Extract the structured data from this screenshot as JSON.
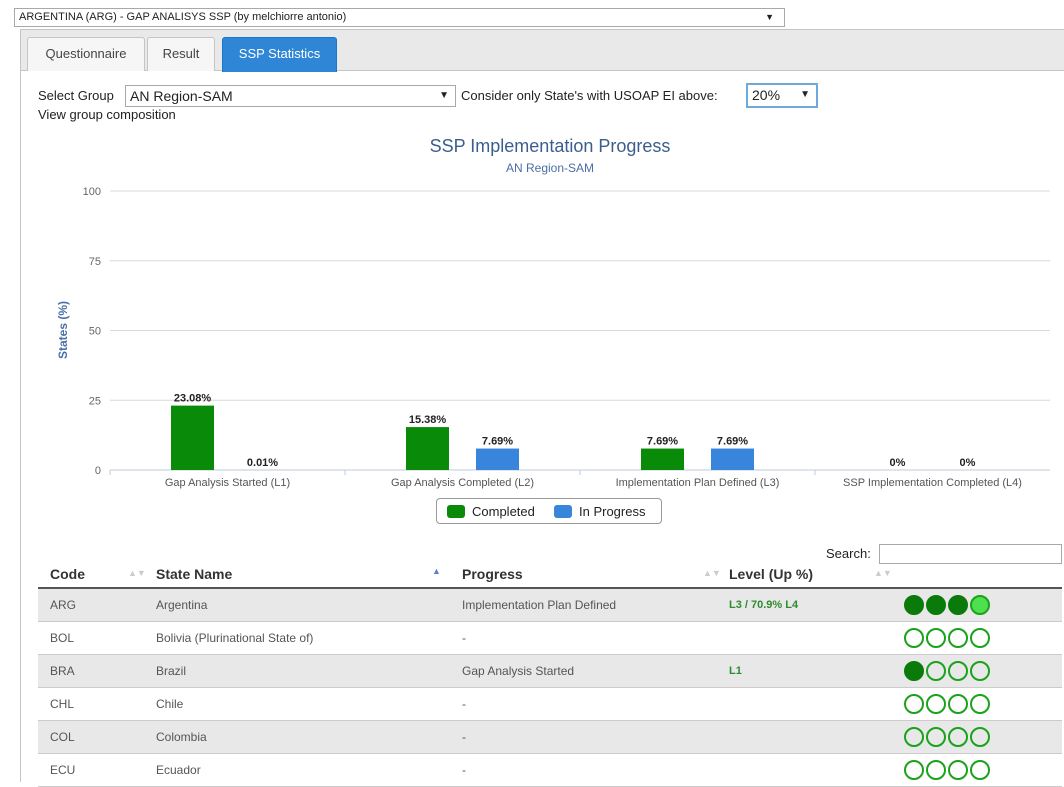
{
  "top_select": {
    "value": "ARGENTINA (ARG) - GAP ANALISYS SSP (by melchiorre antonio)"
  },
  "tabs": [
    {
      "label": "Questionnaire",
      "active": false
    },
    {
      "label": "Result",
      "active": false
    },
    {
      "label": "SSP Statistics",
      "active": true
    }
  ],
  "controls": {
    "select_group_label": "Select Group",
    "select_group_value": "AN Region-SAM",
    "usoap_label": "Consider only State's with USOAP EI above:",
    "usoap_value": "20%",
    "view_group_link": "View group composition"
  },
  "chart_data": {
    "type": "bar",
    "title": "SSP Implementation Progress",
    "subtitle": "AN Region-SAM",
    "ylabel": "States (%)",
    "xlabel": "",
    "ylim": [
      0,
      100
    ],
    "yticks": [
      "0",
      "25",
      "50",
      "75",
      "100"
    ],
    "grid": true,
    "legend_position": "bottom-center",
    "categories": [
      "Gap Analysis Started (L1)",
      "Gap Analysis Completed (L2)",
      "Implementation Plan Defined (L3)",
      "SSP Implementation Completed (L4)"
    ],
    "series": [
      {
        "name": "Completed",
        "color": "#098a09",
        "values": [
          23.08,
          15.38,
          7.69,
          0
        ],
        "labels": [
          "23.08%",
          "15.38%",
          "7.69%",
          "0%"
        ]
      },
      {
        "name": "In Progress",
        "color": "#3a85dc",
        "values": [
          0.01,
          7.69,
          7.69,
          0
        ],
        "labels": [
          "0.01%",
          "7.69%",
          "7.69%",
          "0%"
        ]
      }
    ]
  },
  "table": {
    "search_label": "Search:",
    "search_value": "",
    "columns": [
      "Code",
      "State Name",
      "Progress",
      "Level (Up %)"
    ],
    "rows": [
      {
        "code": "ARG",
        "name": "Argentina",
        "progress": "Implementation Plan Defined",
        "level": "L3 / 70.9% L4",
        "dots": [
          "full",
          "full",
          "full",
          "light"
        ]
      },
      {
        "code": "BOL",
        "name": "Bolivia (Plurinational State of)",
        "progress": "-",
        "level": "",
        "dots": [
          "empty",
          "empty",
          "empty",
          "empty"
        ]
      },
      {
        "code": "BRA",
        "name": "Brazil",
        "progress": "Gap Analysis Started",
        "level": "L1",
        "dots": [
          "full",
          "empty",
          "empty",
          "empty"
        ]
      },
      {
        "code": "CHL",
        "name": "Chile",
        "progress": "-",
        "level": "",
        "dots": [
          "empty",
          "empty",
          "empty",
          "empty"
        ]
      },
      {
        "code": "COL",
        "name": "Colombia",
        "progress": "-",
        "level": "",
        "dots": [
          "empty",
          "empty",
          "empty",
          "empty"
        ]
      },
      {
        "code": "ECU",
        "name": "Ecuador",
        "progress": "-",
        "level": "",
        "dots": [
          "empty",
          "empty",
          "empty",
          "empty"
        ]
      }
    ]
  }
}
